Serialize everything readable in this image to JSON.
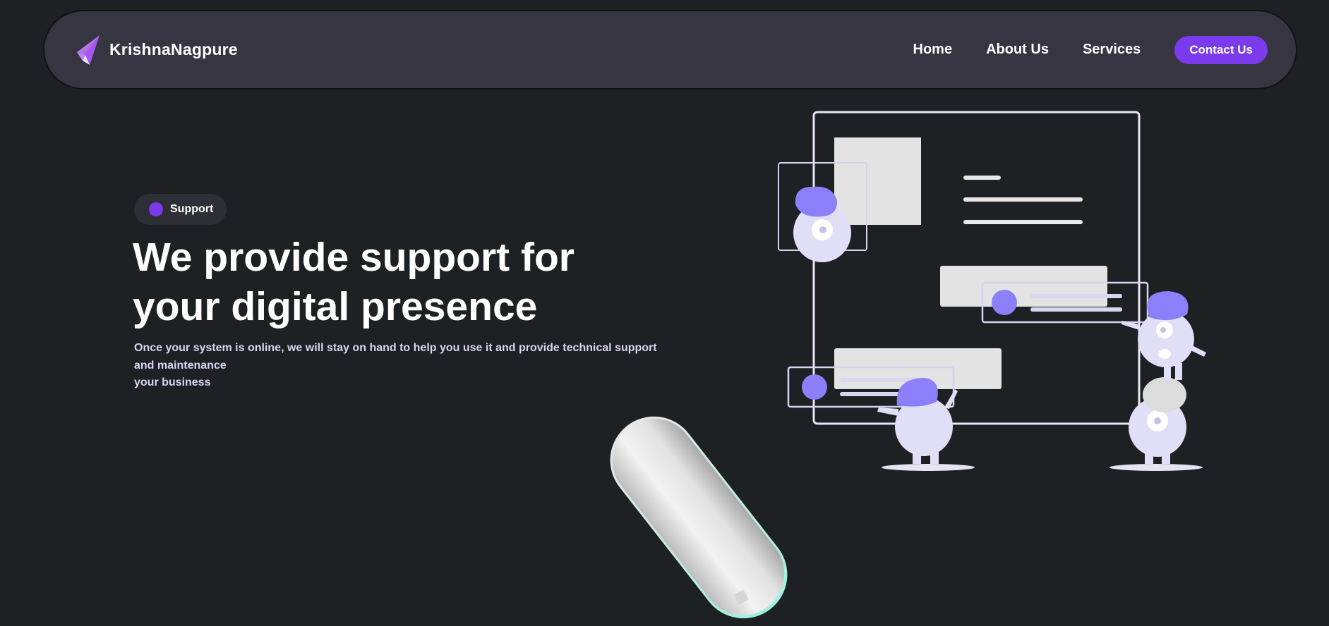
{
  "brand": {
    "name": "KrishnaNagpure",
    "logo_icon": "paper-plane-logo-icon"
  },
  "nav": {
    "links": [
      {
        "label": "Home"
      },
      {
        "label": "About Us"
      },
      {
        "label": "Services"
      }
    ],
    "contact_label": "Contact Us"
  },
  "hero": {
    "badge_label": "Support",
    "title_lines": [
      "We provide support for",
      "your digital presence"
    ],
    "subtitle_lines": [
      "Once your system is online, we will stay on hand to help you use it and provide technical support",
      "and maintenance",
      "your business"
    ]
  },
  "colors": {
    "background": "#1e2124",
    "navbar": "#363541",
    "accent": "#7c3aed",
    "illustration_accent": "#8b80f9",
    "illustration_light": "#e1dff7"
  }
}
